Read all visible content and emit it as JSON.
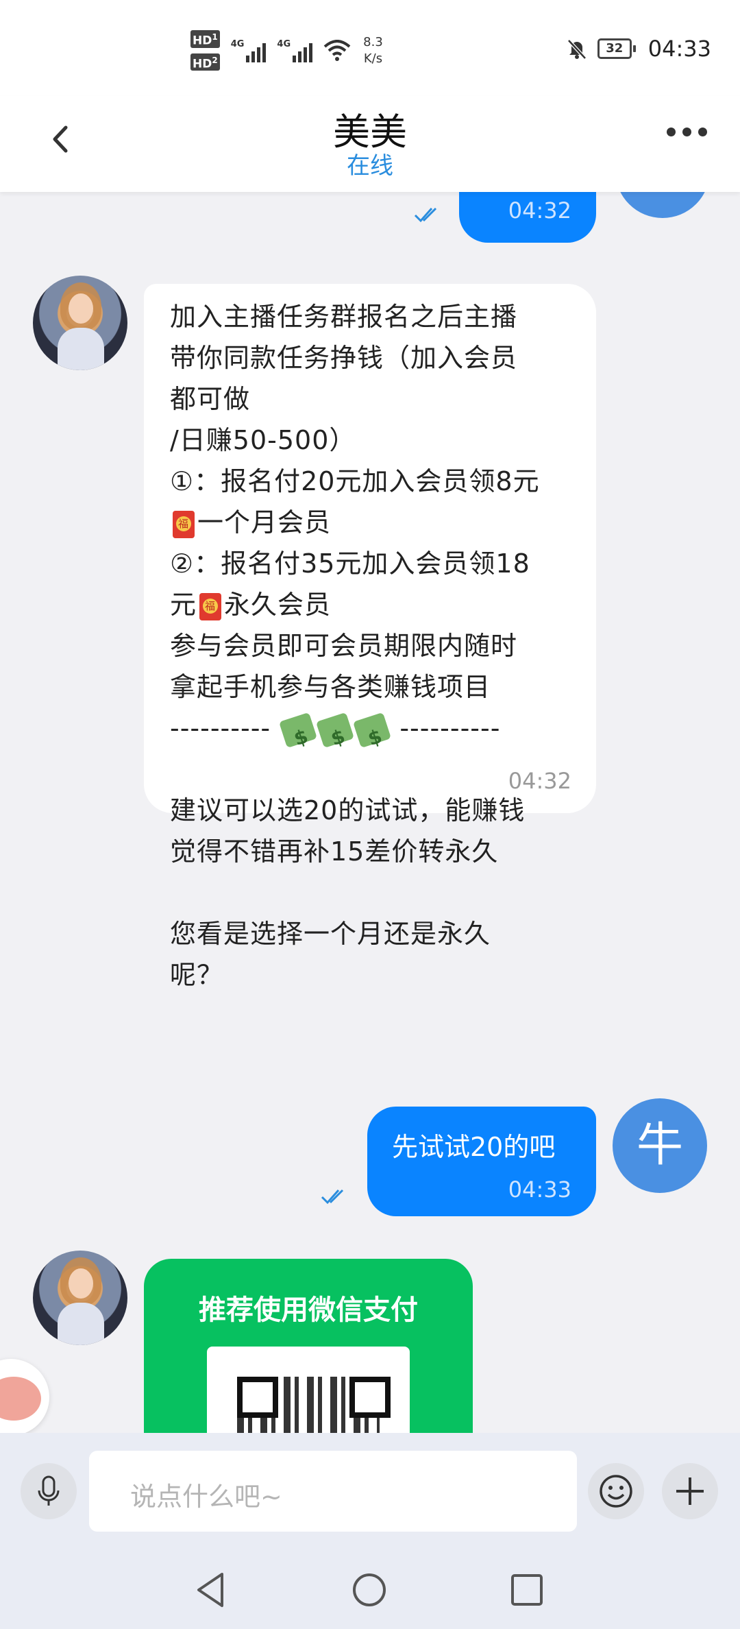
{
  "status_bar": {
    "hd1": "HD",
    "hd1_sub": "1",
    "hd2": "HD",
    "hd2_sub": "2",
    "network1": "4G",
    "network2": "4G",
    "speed_value": "8.3",
    "speed_unit": "K/s",
    "battery": "32",
    "time": "04:33"
  },
  "header": {
    "title": "美美",
    "status": "在线"
  },
  "messages": {
    "m1": {
      "time": "04:32"
    },
    "m2": {
      "p1": "加入主播任务群报名之后主播\n带你同款任务挣钱（加入会员\n都可做\n/日赚50-500）\n①：报名付20元加入会员领8元",
      "p2": "一个月会员",
      "p3": "②：报名付35元加入会员领18\n元",
      "p4": "永久会员",
      "p5": "参与会员即可会员期限内随时\n拿起手机参与各类赚钱项目",
      "dash_left": "----------",
      "dash_right": "----------",
      "p6": "\n建议可以选20的试试，能赚钱\n觉得不错再补15差价转永久\n\n您看是选择一个月还是永久\n呢？",
      "time": "04:32"
    },
    "m3": {
      "text": "先试试20的吧",
      "time": "04:33",
      "avatar": "牛"
    },
    "m4": {
      "title": "推荐使用微信支付"
    }
  },
  "input": {
    "placeholder": "说点什么吧~"
  },
  "icons": {
    "back": "back-arrow-icon",
    "more": "more-dots-icon",
    "mic": "microphone-icon",
    "emoji": "emoji-icon",
    "plus": "plus-icon",
    "nav_back": "nav-back-icon",
    "nav_home": "nav-home-icon",
    "nav_recent": "nav-recent-icon"
  },
  "colors": {
    "accent": "#0a84ff",
    "online": "#2a8dde",
    "wechat_green": "#07c160"
  }
}
